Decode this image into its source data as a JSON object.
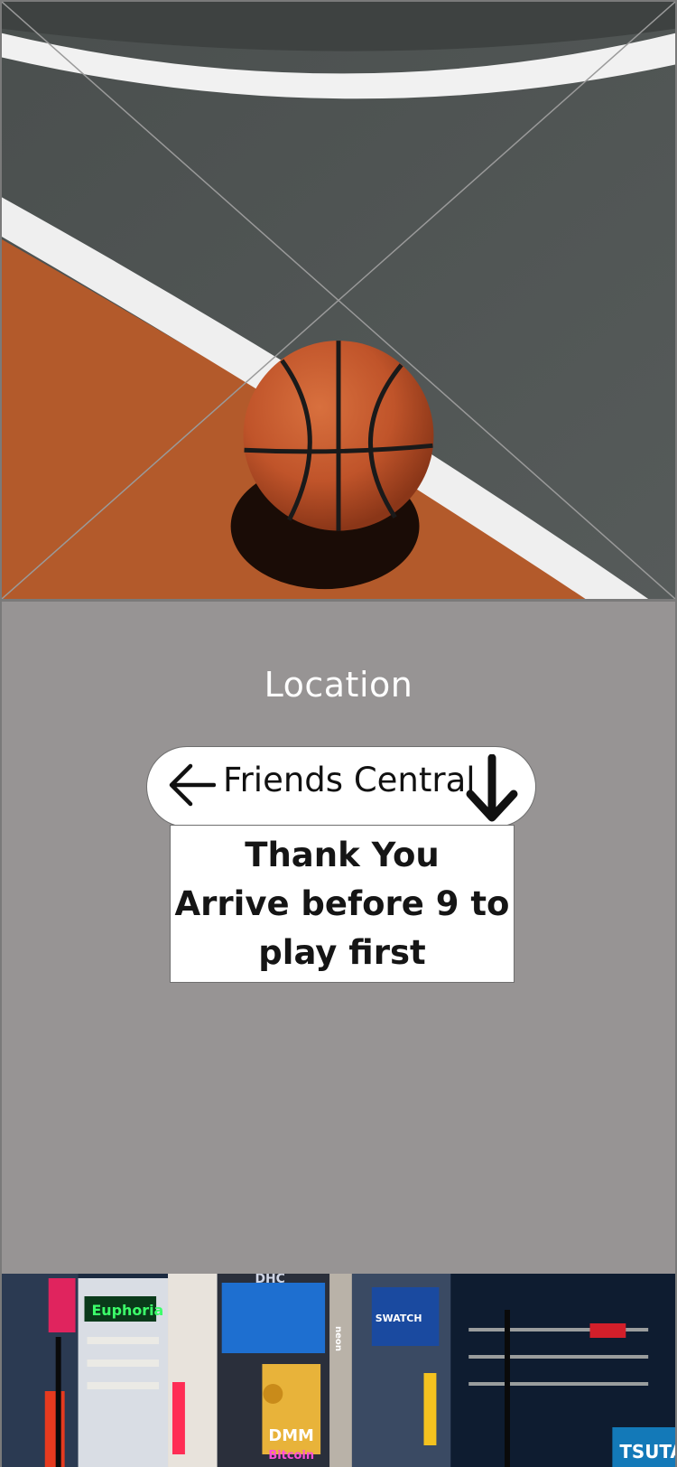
{
  "hero_image": {
    "alt": "basketball-court-photo",
    "icon": "basketball-image",
    "colors": {
      "court_grey": "#4f5453",
      "court_orange": "#b45a2c",
      "line_white": "#f2f2f2",
      "ball": "#c2562b"
    }
  },
  "panel": {
    "background": "#979494",
    "heading": "Location",
    "location_name": "Friends Central",
    "back_icon": "arrow-left-icon",
    "expand_icon": "arrow-down-icon",
    "message_lines": [
      "Thank You",
      "Arrive before 9 to",
      "play first"
    ]
  },
  "city_image": {
    "alt": "city-street-neon-photo",
    "signs": [
      "DHC",
      "Euphoria",
      "SWATCH",
      "DMM",
      "Bitcoin",
      "TSUTA",
      "neon"
    ]
  }
}
